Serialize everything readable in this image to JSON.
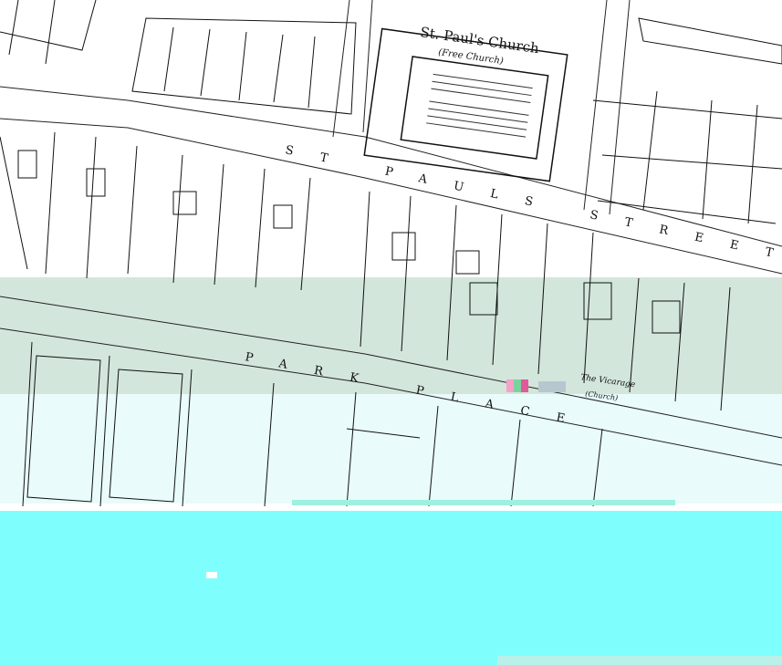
{
  "map": {
    "labels": {
      "church_name": "St. Paul's Church",
      "church_note": "(Free Church)",
      "street_top": "ST PAULS STREET",
      "street_bottom": "PARK PLACE",
      "vicarage": "The Vicarage",
      "vicarage_note": "(Church)"
    },
    "colors": {
      "paper": "#ffffff",
      "ink": "#111111",
      "band_green": "#d3e6dc",
      "band_pale": "#e9fbfb",
      "scan_cyan": "#7ffefe"
    }
  }
}
